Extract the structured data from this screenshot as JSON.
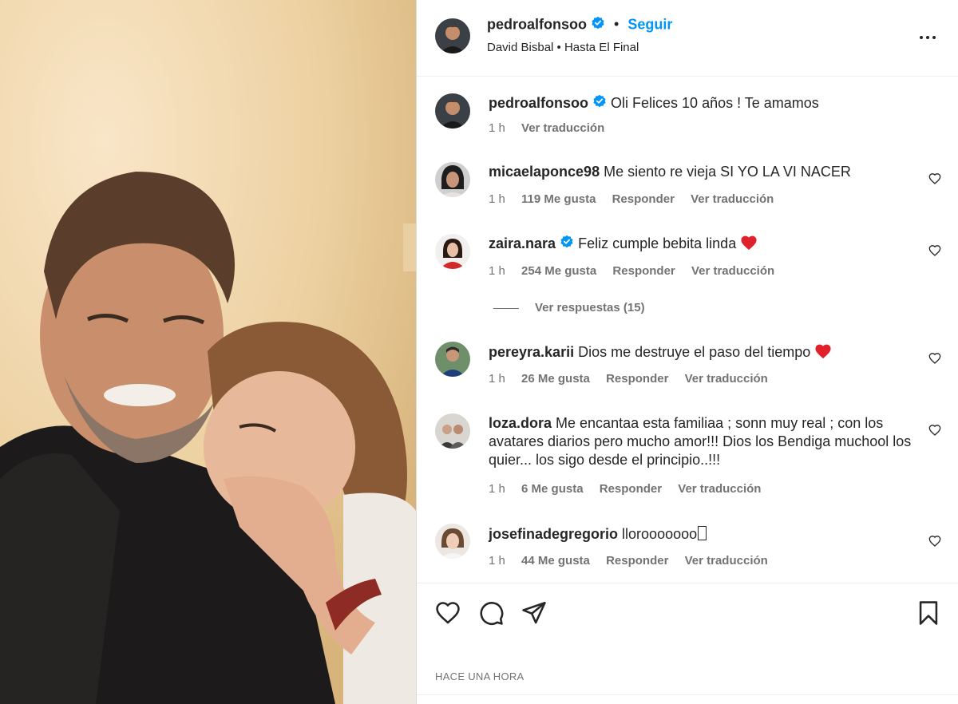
{
  "colors": {
    "accent": "#0095f6",
    "text": "#262626",
    "muted": "#737373",
    "heart_red": "#ff3040"
  },
  "header": {
    "username": "pedroalfonsoo",
    "follow_label": "Seguir",
    "separator": "•",
    "song": "David Bisbal • Hasta El Final"
  },
  "caption": {
    "username": "pedroalfonsoo",
    "text": "Oli Felices 10 años ! Te amamos",
    "time": "1 h",
    "translate": "Ver traducción"
  },
  "comments": [
    {
      "username": "micaelaponce98",
      "text": "Me siento re vieja SI YO LA VI NACER",
      "time": "1 h",
      "likes": "119 Me gusta",
      "reply": "Responder",
      "translate": "Ver traducción"
    },
    {
      "username": "zaira.nara",
      "text": "Feliz cumple bebita linda",
      "time": "1 h",
      "likes": "254 Me gusta",
      "reply": "Responder",
      "translate": "Ver traducción"
    },
    {
      "username": "pereyra.karii",
      "text": "Dios me destruye el paso del tiempo",
      "time": "1 h",
      "likes": "26 Me gusta",
      "reply": "Responder",
      "translate": "Ver traducción"
    },
    {
      "username": "loza.dora",
      "text": "Me encantaa esta familiaa ; sonn muy real ; con los avatares diarios pero mucho amor!!! Dios los Bendiga muchool los quier... los sigo desde el principio..!!!",
      "time": "1 h",
      "likes": "6 Me gusta",
      "reply": "Responder",
      "translate": "Ver traducción"
    },
    {
      "username": "josefinadegregorio",
      "text": "llorooooooo",
      "time": "1 h",
      "likes": "44 Me gusta",
      "reply": "Responder",
      "translate": "Ver traducción"
    }
  ],
  "view_replies": "Ver respuestas (15)",
  "timestamp": "HACE UNA HORA"
}
